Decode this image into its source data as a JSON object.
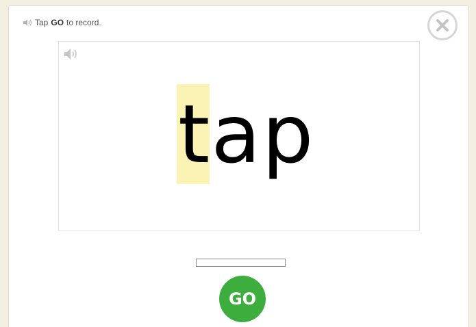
{
  "instruction": {
    "prefix": "Tap",
    "keyword": "GO",
    "suffix": "to record."
  },
  "icons": {
    "instruction_speaker": "speaker-icon",
    "card_speaker": "speaker-icon",
    "close": "close-icon"
  },
  "word": {
    "letters": [
      "t",
      "a",
      "p"
    ],
    "highlighted_index": 0
  },
  "record_progress": 0,
  "go_button": {
    "label": "GO"
  },
  "colors": {
    "background": "#f3efe2",
    "highlight": "#fbf3b3",
    "go_button": "#3dae3d",
    "close_ring": "#d5d5d5"
  }
}
